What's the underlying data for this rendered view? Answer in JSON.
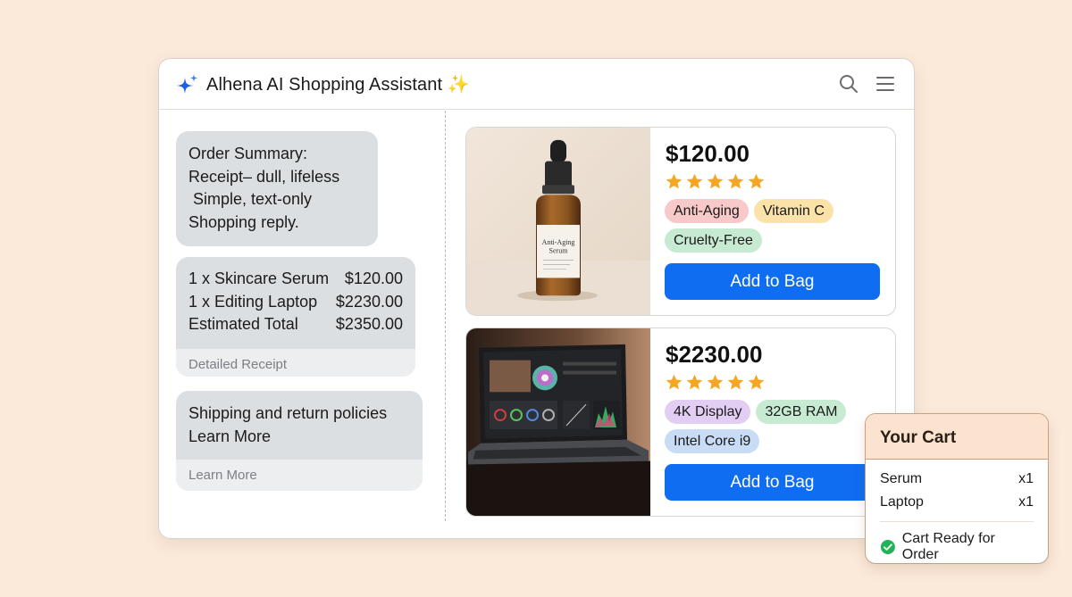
{
  "app": {
    "title": "Alhena AI Shopping Assistant ✨"
  },
  "header": {
    "icons": [
      "sparkle-icon",
      "search-icon",
      "menu-icon"
    ]
  },
  "chat": {
    "order_summary": {
      "lines": [
        "Order Summary:",
        "Receipt– dull, lifeless",
        " Simple, text-only",
        "Shopping reply."
      ]
    },
    "receipt": {
      "rows": [
        {
          "label": "1 x Skincare Serum",
          "value": "$120.00"
        },
        {
          "label": "1 x Editing Laptop",
          "value": "$2230.00"
        },
        {
          "label": "Estimated Total",
          "value": "$2350.00"
        }
      ],
      "footer": "Detailed Receipt"
    },
    "policies": {
      "lines": [
        "Shipping and return policies",
        "Learn More"
      ],
      "footer": "Learn More"
    }
  },
  "products": [
    {
      "image": "serum-bottle-image",
      "bottle_label": "Anti-Aging Serum",
      "price": "$120.00",
      "rating": 5,
      "tags": [
        {
          "label": "Anti-Aging",
          "color": "#f7c9c9"
        },
        {
          "label": "Vitamin C",
          "color": "#fbe2a8"
        },
        {
          "label": "Cruelty-Free",
          "color": "#c7ebd2"
        }
      ],
      "button": "Add to Bag"
    },
    {
      "image": "laptop-image",
      "price": "$2230.00",
      "rating": 5,
      "tags": [
        {
          "label": "4K Display",
          "color": "#e2cdf3"
        },
        {
          "label": "32GB RAM",
          "color": "#c7ebd2"
        },
        {
          "label": "Intel Core i9",
          "color": "#c9dcf6"
        }
      ],
      "button": "Add to Bag"
    }
  ],
  "cart": {
    "title": "Your Cart",
    "items": [
      {
        "name": "Serum",
        "qty": "x1"
      },
      {
        "name": "Laptop",
        "qty": "x1"
      }
    ],
    "status": "Cart Ready for Order"
  },
  "colors": {
    "accent": "#0f6df1",
    "background": "#fbe9da",
    "star": "#f5a623",
    "check": "#22b358"
  }
}
